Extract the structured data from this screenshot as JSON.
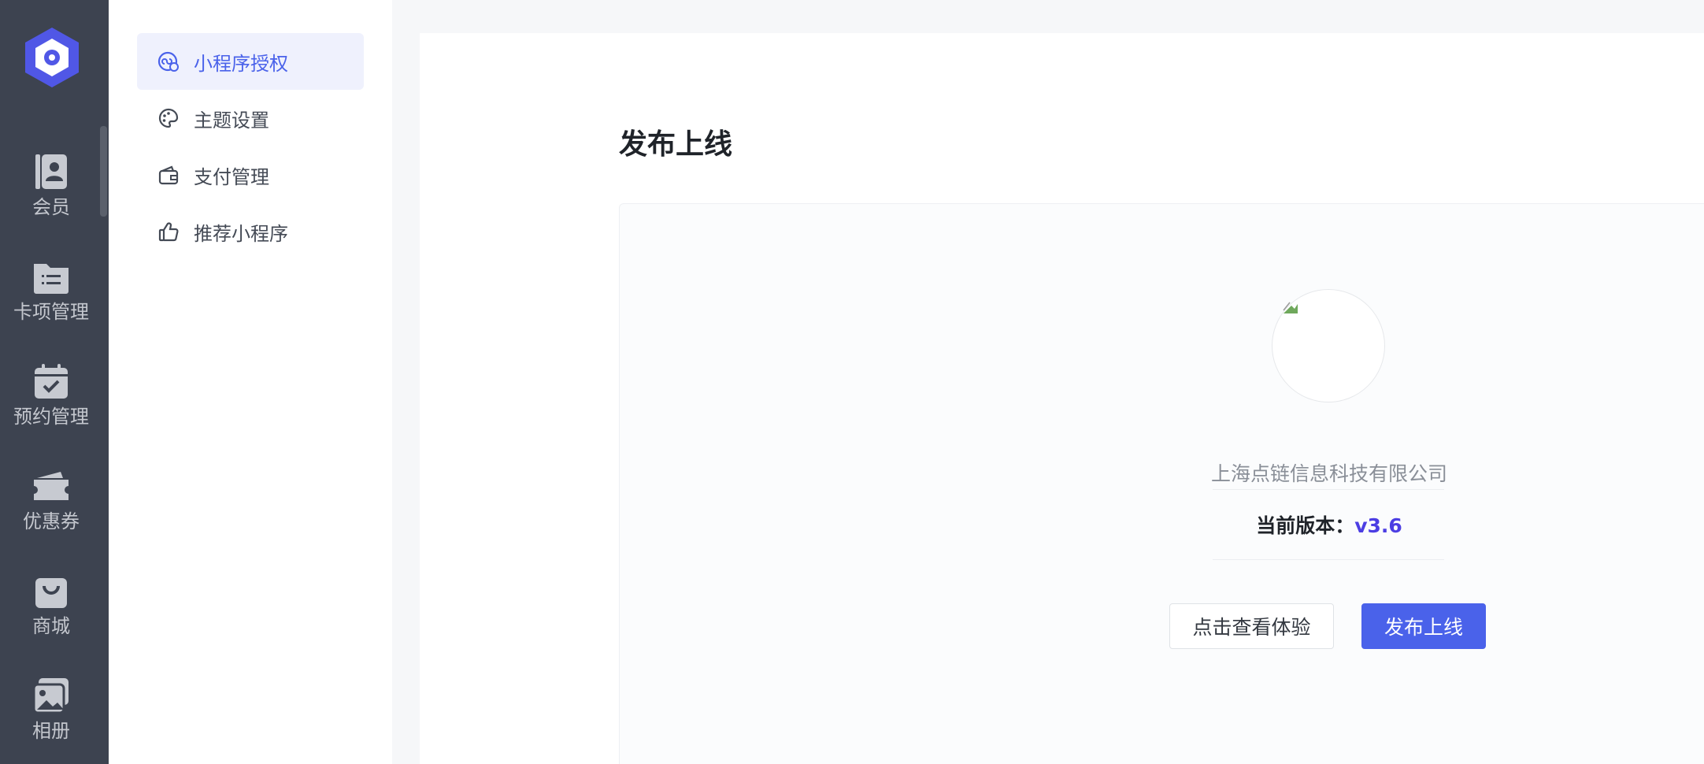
{
  "rail": {
    "items": [
      {
        "label": "会员",
        "icon": "member-card-icon"
      },
      {
        "label": "卡项管理",
        "icon": "folder-list-icon"
      },
      {
        "label": "预约管理",
        "icon": "calendar-check-icon"
      },
      {
        "label": "优惠券",
        "icon": "coupon-icon"
      },
      {
        "label": "商城",
        "icon": "shopping-bag-icon"
      },
      {
        "label": "相册",
        "icon": "photo-album-icon"
      }
    ]
  },
  "subnav": {
    "items": [
      {
        "label": "小程序授权",
        "icon": "miniprogram-auth-icon",
        "active": true
      },
      {
        "label": "主题设置",
        "icon": "palette-icon",
        "active": false
      },
      {
        "label": "支付管理",
        "icon": "wallet-icon",
        "active": false
      },
      {
        "label": "推荐小程序",
        "icon": "thumbs-up-icon",
        "active": false
      }
    ]
  },
  "main": {
    "title": "发布上线",
    "company": "上海点链信息科技有限公司",
    "version_label": "当前版本：",
    "version_value": "v3.6",
    "preview_button": "点击查看体验",
    "publish_button": "发布上线"
  },
  "colors": {
    "rail_bg": "#3d4350",
    "accent": "#4a62ea",
    "version_accent": "#4c3ee3",
    "active_bg": "#eff1fd"
  }
}
